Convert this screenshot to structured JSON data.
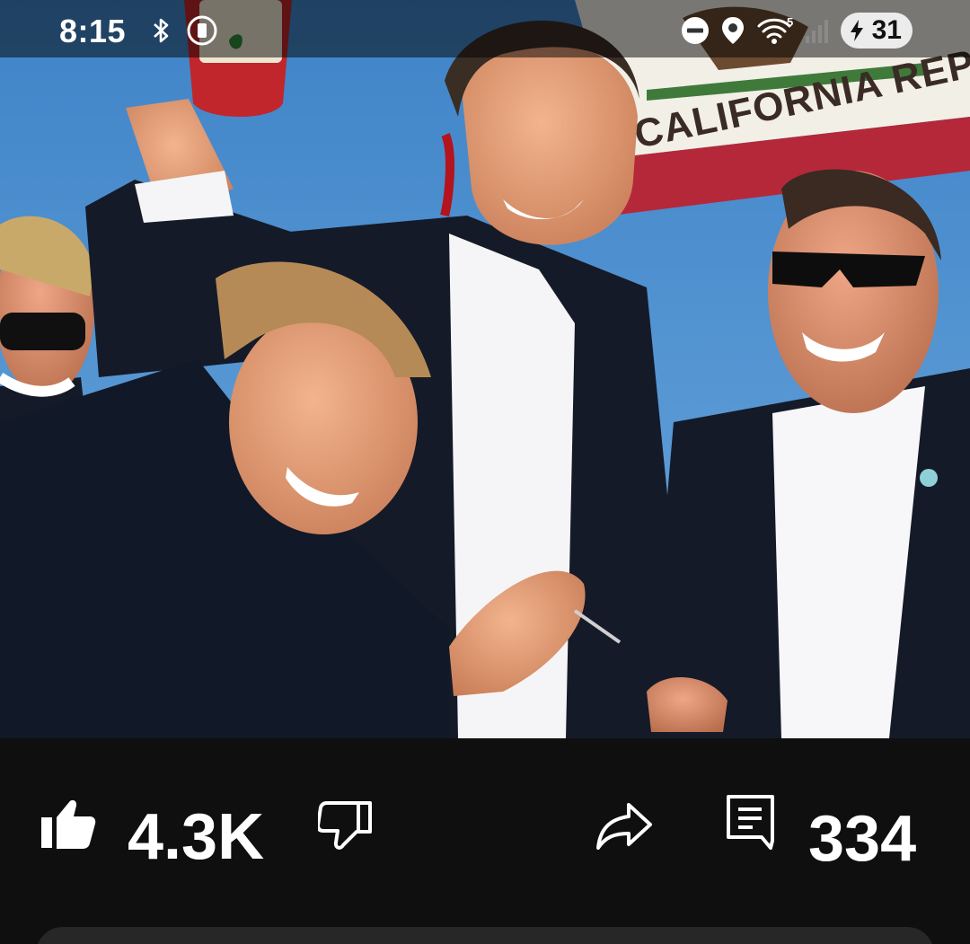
{
  "status_bar": {
    "time": "8:15",
    "wifi_badge": "5",
    "battery_level": "31",
    "icons": [
      "bluetooth-icon",
      "screen-record-icon",
      "do-not-disturb-icon",
      "location-icon",
      "wifi-icon",
      "signal-icon",
      "battery-charging-icon"
    ]
  },
  "post": {
    "image_text": {
      "flag_text": "CALIFORNIA REPUBLIC"
    },
    "like_count": "4.3K",
    "comment_count": "334"
  },
  "colors": {
    "background": "#0f0f0f",
    "text": "#ffffff",
    "sky": "#4d8fcf",
    "flag_red": "#b5283a",
    "suit": "#151a28"
  }
}
